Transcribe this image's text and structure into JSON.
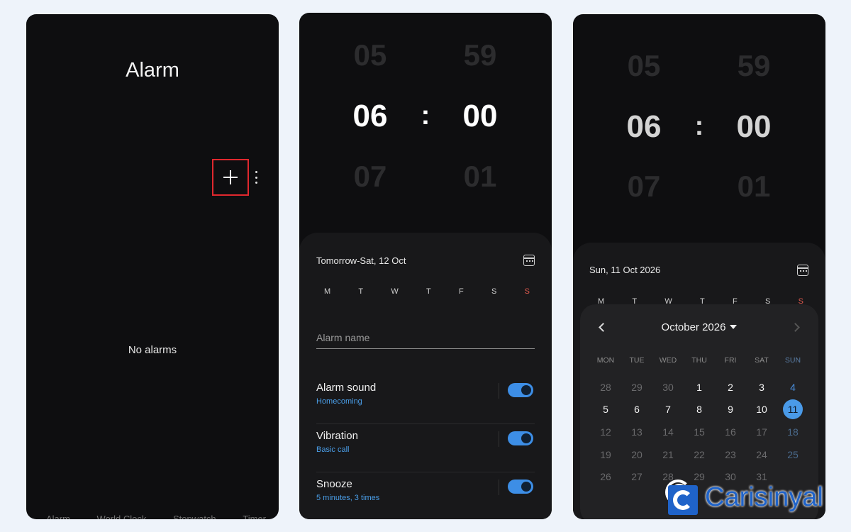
{
  "panel1": {
    "title": "Alarm",
    "empty_text": "No alarms",
    "bottom_tabs": [
      "Alarm",
      "World Clock",
      "Stopwatch",
      "Timer"
    ]
  },
  "panel2": {
    "time_above": {
      "hour": "05",
      "minute": "59"
    },
    "time_selected": {
      "hour": "06",
      "minute": "00"
    },
    "time_below": {
      "hour": "07",
      "minute": "01"
    },
    "separator": ":",
    "date_text": "Tomorrow-Sat, 12 Oct",
    "weekdays": [
      "M",
      "T",
      "W",
      "T",
      "F",
      "S",
      "S"
    ],
    "alarm_name_placeholder": "Alarm name",
    "settings": [
      {
        "title": "Alarm sound",
        "subtitle": "Homecoming",
        "enabled": true
      },
      {
        "title": "Vibration",
        "subtitle": "Basic call",
        "enabled": true
      },
      {
        "title": "Snooze",
        "subtitle": "5 minutes, 3 times",
        "enabled": true
      }
    ]
  },
  "panel3": {
    "time_above": {
      "hour": "05",
      "minute": "59"
    },
    "time_selected": {
      "hour": "06",
      "minute": "00"
    },
    "time_below": {
      "hour": "07",
      "minute": "01"
    },
    "separator": ":",
    "date_text": "Sun, 11 Oct 2026",
    "weekdays": [
      "M",
      "T",
      "W",
      "T",
      "F",
      "S",
      "S"
    ],
    "calendar": {
      "month_label": "October 2026",
      "weekday_headers": [
        "MON",
        "TUE",
        "WED",
        "THU",
        "FRI",
        "SAT",
        "SUN"
      ],
      "weeks": [
        [
          "28",
          "29",
          "30",
          "1",
          "2",
          "3",
          "4"
        ],
        [
          "5",
          "6",
          "7",
          "8",
          "9",
          "10",
          "11"
        ],
        [
          "12",
          "13",
          "14",
          "15",
          "16",
          "17",
          "18"
        ],
        [
          "19",
          "20",
          "21",
          "22",
          "23",
          "24",
          "25"
        ],
        [
          "26",
          "27",
          "28",
          "29",
          "30",
          "31",
          ""
        ]
      ],
      "selected_day": "11"
    }
  },
  "watermark": {
    "text": "Carisinyal"
  },
  "colors": {
    "accent": "#4a9ae8",
    "toggle_on": "#3d8ee6",
    "sunday_red": "#e05a4e",
    "highlight_red": "#e0282e",
    "watermark_blue": "#1f63c9"
  }
}
